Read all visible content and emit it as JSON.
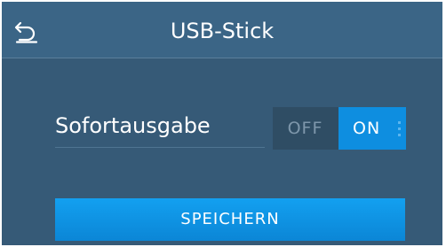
{
  "header": {
    "title": "USB-Stick",
    "back_icon": "back-arrow-icon"
  },
  "setting": {
    "label": "Sofortausgabe",
    "toggle": {
      "off_label": "OFF",
      "on_label": "ON",
      "selected": "ON"
    }
  },
  "actions": {
    "save_label": "SPEICHERN"
  },
  "colors": {
    "background": "#365a77",
    "header": "#3b6586",
    "accent": "#0e8ee0"
  }
}
